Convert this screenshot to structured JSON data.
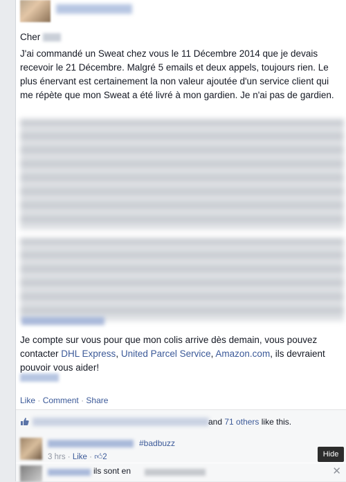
{
  "post": {
    "salutation": "Cher",
    "paragraph1": "J'ai commandé un Sweat chez vous le 11 Décembre 2014 que je devais recevoir le 21 Décembre. Malgré 5 emails et deux appels, toujours rien. Le plus énervant est certainement la non valeur ajoutée d'un service client qui me répète que mon Sweat a été livré à mon gardien. Je n'ai pas de gardien.",
    "paragraph2_start": "Je compte sur vous pour que mon colis arrive dès demain, vous pouvez contacter ",
    "link_dhl": "DHL Express",
    "sep_comma1": ", ",
    "link_ups": "United Parcel Service",
    "sep_comma2": ", ",
    "link_amazon": "Amazon.com",
    "paragraph2_end": ", ils devraient pouvoir vous aider!"
  },
  "actions": {
    "like": "Like",
    "separator": "·",
    "comment": "Comment",
    "share": "Share"
  },
  "likes": {
    "and": "and",
    "others": "71 others",
    "suffix": "like this."
  },
  "comments": [
    {
      "hashtag": "#badbuzz",
      "time": "3 hrs",
      "separator": "·",
      "like": "Like",
      "like_count": "2",
      "hide_label": "Hide"
    },
    {
      "text": "ils sont en",
      "close": "✕"
    }
  ],
  "icons": {
    "like_thumb": "thumbs-up-icon",
    "close": "close-icon"
  },
  "colors": {
    "link": "#3b5998",
    "meta": "#9197a3",
    "background": "#e9ebee"
  }
}
